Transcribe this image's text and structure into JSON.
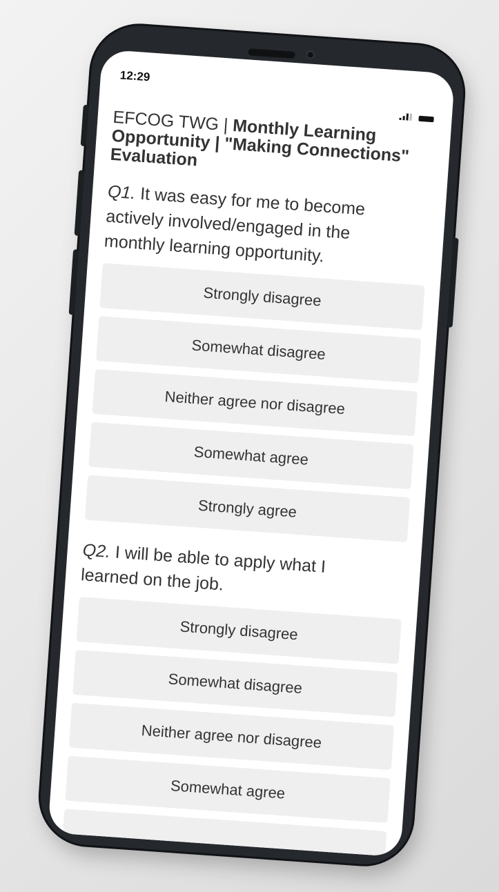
{
  "status_bar": {
    "time": "12:29",
    "signal_icon": "signal-bars-icon",
    "battery_icon": "battery-icon"
  },
  "survey": {
    "title_prefix": "EFCOG TWG | ",
    "title_bold": "Monthly Learning Opportunity | \"Making Connections\" Evaluation"
  },
  "questions": [
    {
      "number": "Q1.",
      "text": " It was easy for me to become actively involved/engaged in the monthly learning opportunity.",
      "options": [
        "Strongly disagree",
        "Somewhat disagree",
        "Neither agree nor disagree",
        "Somewhat agree",
        "Strongly agree"
      ]
    },
    {
      "number": "Q2.",
      "text": " I will be able to apply what I learned on the job.",
      "options": [
        "Strongly disagree",
        "Somewhat disagree",
        "Neither agree nor disagree",
        "Somewhat agree",
        ""
      ]
    }
  ],
  "colors": {
    "option_background": "#efefef",
    "text": "#333333",
    "phone_frame": "#25282c"
  }
}
